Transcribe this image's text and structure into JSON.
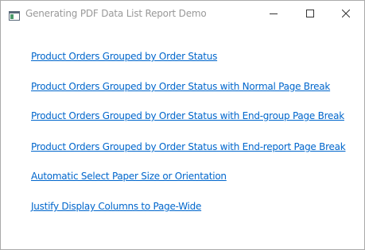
{
  "window": {
    "title": "Generating PDF Data List Report Demo",
    "icon": "app-window-icon",
    "controls": [
      "minimize-icon",
      "maximize-icon",
      "close-icon"
    ]
  },
  "links": [
    {
      "label": "Product Orders Grouped by Order Status"
    },
    {
      "label": "Product Orders Grouped by Order Status with Normal Page Break"
    },
    {
      "label": "Product Orders Grouped by Order Status with End-group Page Break"
    },
    {
      "label": "Product Orders Grouped by Order Status with End-report Page Break"
    },
    {
      "label": "Automatic Select Paper Size or Orientation"
    },
    {
      "label": "Justify Display Columns to Page-Wide"
    }
  ],
  "colors": {
    "link": "#0066cc",
    "title_text": "#999999",
    "background": "#ffffff",
    "border": "#aaaaaa"
  }
}
